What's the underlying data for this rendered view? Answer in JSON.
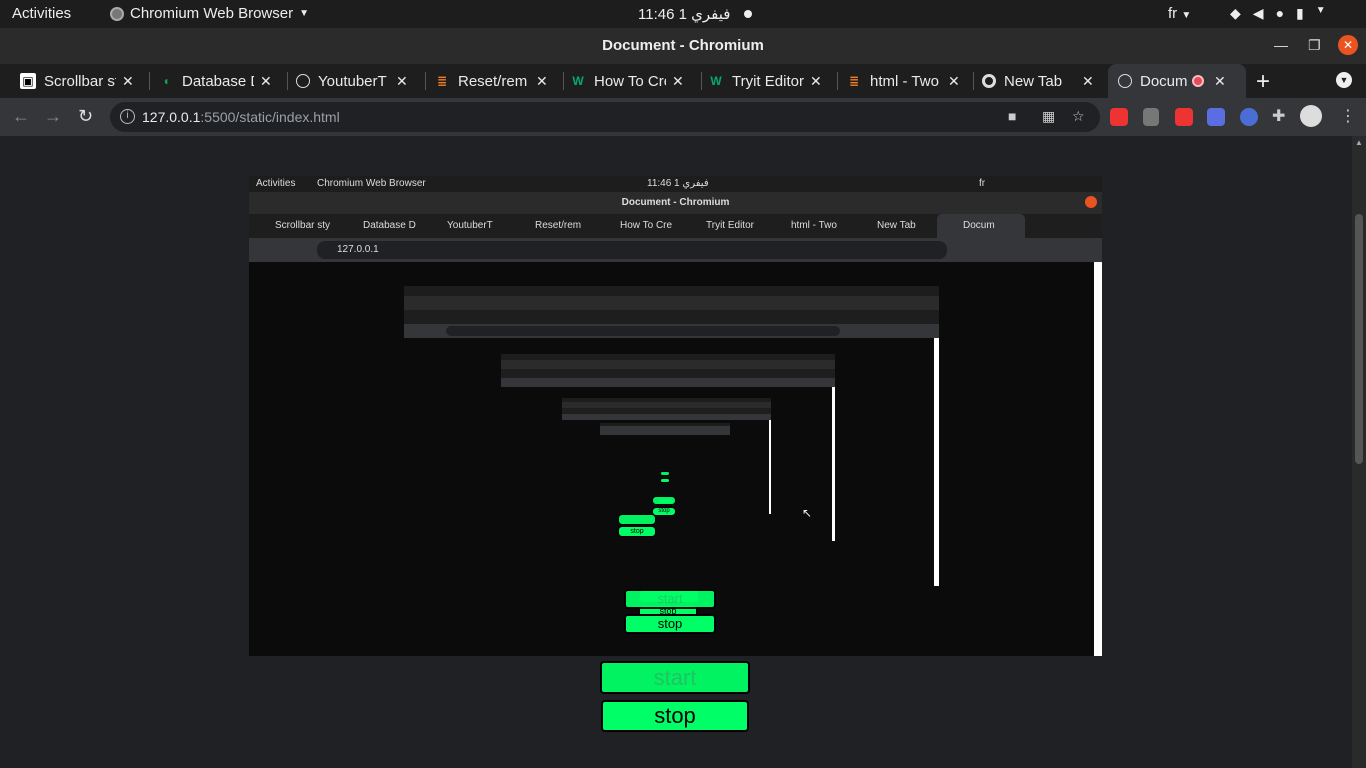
{
  "topbar": {
    "activities": "Activities",
    "app_menu": "Chromium Web Browser",
    "clock": "11:46 1 فيفري",
    "lang": "fr"
  },
  "window": {
    "title": "Document - Chromium"
  },
  "tabs": [
    {
      "label": "Scrollbar sty",
      "icon": "scrollbar-icon"
    },
    {
      "label": "Database D",
      "icon": "mongodb-icon"
    },
    {
      "label": "YoutuberT",
      "icon": "globe-icon"
    },
    {
      "label": "Reset/rem",
      "icon": "stackoverflow-icon"
    },
    {
      "label": "How To Cre",
      "icon": "w3schools-icon"
    },
    {
      "label": "Tryit Editor",
      "icon": "w3schools-icon"
    },
    {
      "label": "html - Two",
      "icon": "stackoverflow-icon"
    },
    {
      "label": "New Tab",
      "icon": "chrome-icon"
    },
    {
      "label": "Docum",
      "icon": "globe-icon",
      "active": true
    }
  ],
  "toolbar": {
    "url_host": "127.0.0.1",
    "url_path": ":5500/static/index.html"
  },
  "page": {
    "start_label": "start",
    "stop_label": "stop"
  },
  "colors": {
    "button_green": "#00ff66",
    "accent_close": "#e95420"
  }
}
